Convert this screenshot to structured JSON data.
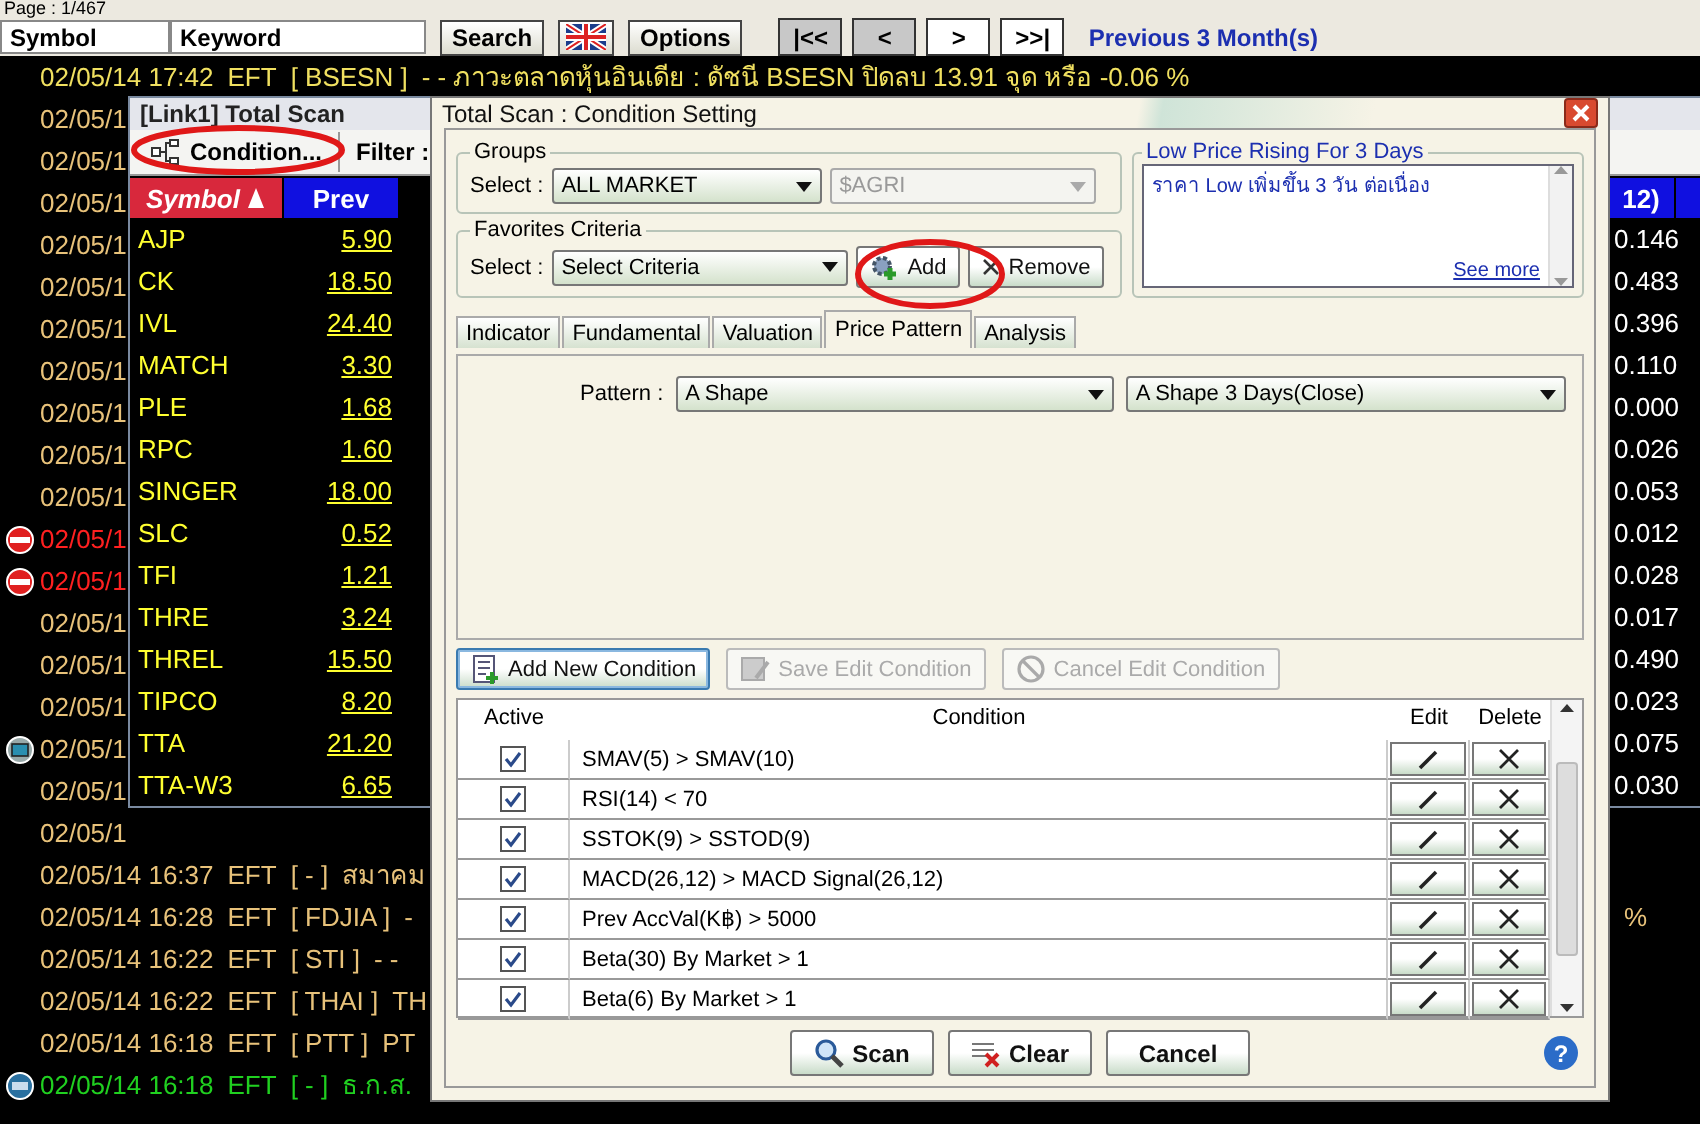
{
  "toolbar": {
    "page_label": "Page : 1/467",
    "symbol_field": {
      "value": "Symbol"
    },
    "keyword_field": {
      "value": "Keyword"
    },
    "buttons": [
      {
        "kind": "text",
        "label": "Search"
      },
      {
        "kind": "flag"
      },
      {
        "kind": "text",
        "label": "Options"
      }
    ],
    "nav": [
      {
        "label": "|<<",
        "disabled": true
      },
      {
        "label": "<",
        "disabled": true
      },
      {
        "label": ">",
        "disabled": false
      },
      {
        "label": ">>|",
        "disabled": false
      }
    ],
    "period_link": "Previous 3 Month(s)"
  },
  "news": [
    {
      "kind": "plain",
      "datetime": "02/05/14 17:42",
      "source": "EFT",
      "tag": "[ BSESN ]",
      "headline": "- - ภาวะตลาดหุ้นอินเดีย : ดัชนี BSESN ปิดลบ 13.91 จุด หรือ -0.06 %",
      "color": "#f0e060"
    },
    {
      "kind": "plain",
      "datetime": "02/05/1",
      "color": "#e8c27a"
    },
    {
      "kind": "plain",
      "datetime": "02/05/1",
      "color": "#e8c27a"
    },
    {
      "kind": "plain",
      "datetime": "02/05/1",
      "color": "#e8c27a"
    },
    {
      "kind": "plain",
      "datetime": "02/05/1",
      "color": "#e8c27a"
    },
    {
      "kind": "plain",
      "datetime": "02/05/1",
      "color": "#e8c27a"
    },
    {
      "kind": "plain",
      "datetime": "02/05/1",
      "color": "#e8c27a"
    },
    {
      "kind": "plain",
      "datetime": "02/05/1",
      "color": "#e8c27a"
    },
    {
      "kind": "plain",
      "datetime": "02/05/1",
      "color": "#e8c27a"
    },
    {
      "kind": "plain",
      "datetime": "02/05/1",
      "color": "#e8c27a"
    },
    {
      "kind": "plain",
      "datetime": "02/05/1",
      "color": "#e8c27a"
    },
    {
      "kind": "alert",
      "datetime": "02/05/1",
      "color": "#ff2020"
    },
    {
      "kind": "alert",
      "datetime": "02/05/1",
      "color": "#ff2020"
    },
    {
      "kind": "plain",
      "datetime": "02/05/1",
      "color": "#e8c27a"
    },
    {
      "kind": "plain",
      "datetime": "02/05/1",
      "color": "#e8c27a"
    },
    {
      "kind": "plain",
      "datetime": "02/05/1",
      "color": "#e8c27a"
    },
    {
      "kind": "monitor",
      "datetime": "02/05/1",
      "color": "#e8c27a"
    },
    {
      "kind": "plain",
      "datetime": "02/05/1",
      "color": "#e8c27a"
    },
    {
      "kind": "plain",
      "datetime": "02/05/1",
      "color": "#e8c27a"
    },
    {
      "kind": "plain",
      "datetime": "02/05/14 16:37",
      "source": "EFT",
      "tag": "[ - ]",
      "headline": "สมาคม",
      "color": "#e8c27a"
    },
    {
      "kind": "plain",
      "datetime": "02/05/14 16:28",
      "source": "EFT",
      "tag": "[ FDJIA ]",
      "headline": "-",
      "tail": "%",
      "color": "#e8c27a"
    },
    {
      "kind": "plain",
      "datetime": "02/05/14 16:22",
      "source": "EFT",
      "tag": "[ STI ]",
      "headline": "- -",
      "color": "#e8c27a"
    },
    {
      "kind": "plain",
      "datetime": "02/05/14 16:22",
      "source": "EFT",
      "tag": "[ THAI ]",
      "headline": "TH",
      "color": "#e8c27a"
    },
    {
      "kind": "plain",
      "datetime": "02/05/14 16:18",
      "source": "EFT",
      "tag": "[ PTT ]",
      "headline": "PT",
      "color": "#e8c27a"
    },
    {
      "kind": "pr",
      "datetime": "02/05/14 16:18",
      "source": "EFT",
      "tag": "[ - ]",
      "headline": "ธ.ก.ส.",
      "color": "#20d020"
    }
  ],
  "scan_window": {
    "title": "[Link1] Total Scan",
    "condition_button": "Condition...",
    "filter_label": "Filter :",
    "columns": [
      "Symbol",
      "Prev",
      "12)"
    ],
    "rows": [
      {
        "symbol": "AJP",
        "prev": "5.90",
        "column_3": "0.146"
      },
      {
        "symbol": "CK",
        "prev": "18.50",
        "column_3": "0.483"
      },
      {
        "symbol": "IVL",
        "prev": "24.40",
        "column_3": "0.396"
      },
      {
        "symbol": "MATCH",
        "prev": "3.30",
        "column_3": "0.110"
      },
      {
        "symbol": "PLE",
        "prev": "1.68",
        "column_3": "0.000"
      },
      {
        "symbol": "RPC",
        "prev": "1.60",
        "column_3": "0.026"
      },
      {
        "symbol": "SINGER",
        "prev": "18.00",
        "column_3": "0.053"
      },
      {
        "symbol": "SLC",
        "prev": "0.52",
        "column_3": "0.012"
      },
      {
        "symbol": "TFI",
        "prev": "1.21",
        "column_3": "0.028"
      },
      {
        "symbol": "THRE",
        "prev": "3.24",
        "column_3": "0.017"
      },
      {
        "symbol": "THREL",
        "prev": "15.50",
        "column_3": "0.490"
      },
      {
        "symbol": "TIPCO",
        "prev": "8.20",
        "column_3": "0.023"
      },
      {
        "symbol": "TTA",
        "prev": "21.20",
        "column_3": "0.075"
      },
      {
        "symbol": "TTA-W3",
        "prev": "6.65",
        "column_3": "0.030"
      }
    ]
  },
  "dialog": {
    "title": "Total Scan : Condition Setting",
    "groups": {
      "legend": "Groups",
      "select_label": "Select :",
      "market": "ALL MARKET",
      "subgroup": "$AGRI"
    },
    "favorites": {
      "legend": "Favorites Criteria",
      "select_label": "Select :",
      "criteria": "Select Criteria",
      "add": "Add",
      "remove": "Remove"
    },
    "description": {
      "title": "Low Price Rising For 3 Days",
      "text": "ราคา Low เพิ่มขึ้น 3 วัน ต่อเนื่อง",
      "link": "See more"
    },
    "tabs": [
      {
        "label": "Indicator",
        "selected": false
      },
      {
        "label": "Fundamental",
        "selected": false
      },
      {
        "label": "Valuation",
        "selected": false
      },
      {
        "label": "Price Pattern",
        "selected": true
      },
      {
        "label": "Analysis",
        "selected": false
      }
    ],
    "pattern": {
      "label": "Pattern :",
      "shape": "A Shape",
      "variant": "A Shape 3 Days(Close)"
    },
    "actions": [
      {
        "kind": "add",
        "label": "Add New Condition",
        "disabled": false
      },
      {
        "kind": "save",
        "label": "Save Edit Condition",
        "disabled": true
      },
      {
        "kind": "cancel",
        "label": "Cancel Edit Condition",
        "disabled": true
      }
    ],
    "conditions": {
      "columns": [
        "Active",
        "Condition",
        "Edit",
        "Delete"
      ],
      "rows": [
        {
          "active": true,
          "condition": "SMAV(5) > SMAV(10)"
        },
        {
          "active": true,
          "condition": "RSI(14) < 70"
        },
        {
          "active": true,
          "condition": "SSTOK(9) > SSTOD(9)"
        },
        {
          "active": true,
          "condition": "MACD(26,12) > MACD Signal(26,12)"
        },
        {
          "active": true,
          "condition": "Prev AccVal(K฿) > 5000"
        },
        {
          "active": true,
          "condition": "Beta(30) By Market > 1"
        },
        {
          "active": true,
          "condition": "Beta(6) By Market > 1"
        }
      ]
    },
    "buttons": [
      {
        "kind": "scan",
        "label": "Scan"
      },
      {
        "kind": "clear",
        "label": "Clear"
      },
      {
        "kind": "plain",
        "label": "Cancel"
      }
    ],
    "help": "?"
  }
}
